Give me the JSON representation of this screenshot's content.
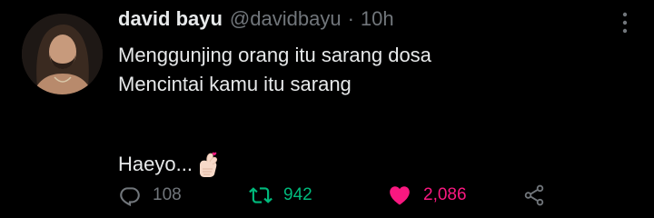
{
  "tweet": {
    "display_name": "david bayu",
    "handle": "@davidbayu",
    "separator": "·",
    "time": "10h",
    "text_lines": [
      "Menggunjing orang itu sarang dosa",
      "Mencintai kamu itu sarang"
    ],
    "closing_text": "Haeyo...",
    "emoji": "finger-heart-hand-emoji"
  },
  "actions": {
    "replies": "108",
    "retweets": "942",
    "likes": "2,086"
  },
  "colors": {
    "background": "#000000",
    "text": "#e7e9ea",
    "secondary": "#71767b",
    "retweet_active": "#00ba7c",
    "like_active": "#f91880"
  },
  "icons": {
    "more": "more-vertical-icon",
    "reply": "reply-icon",
    "retweet": "retweet-icon",
    "like": "heart-icon",
    "share": "share-icon"
  }
}
